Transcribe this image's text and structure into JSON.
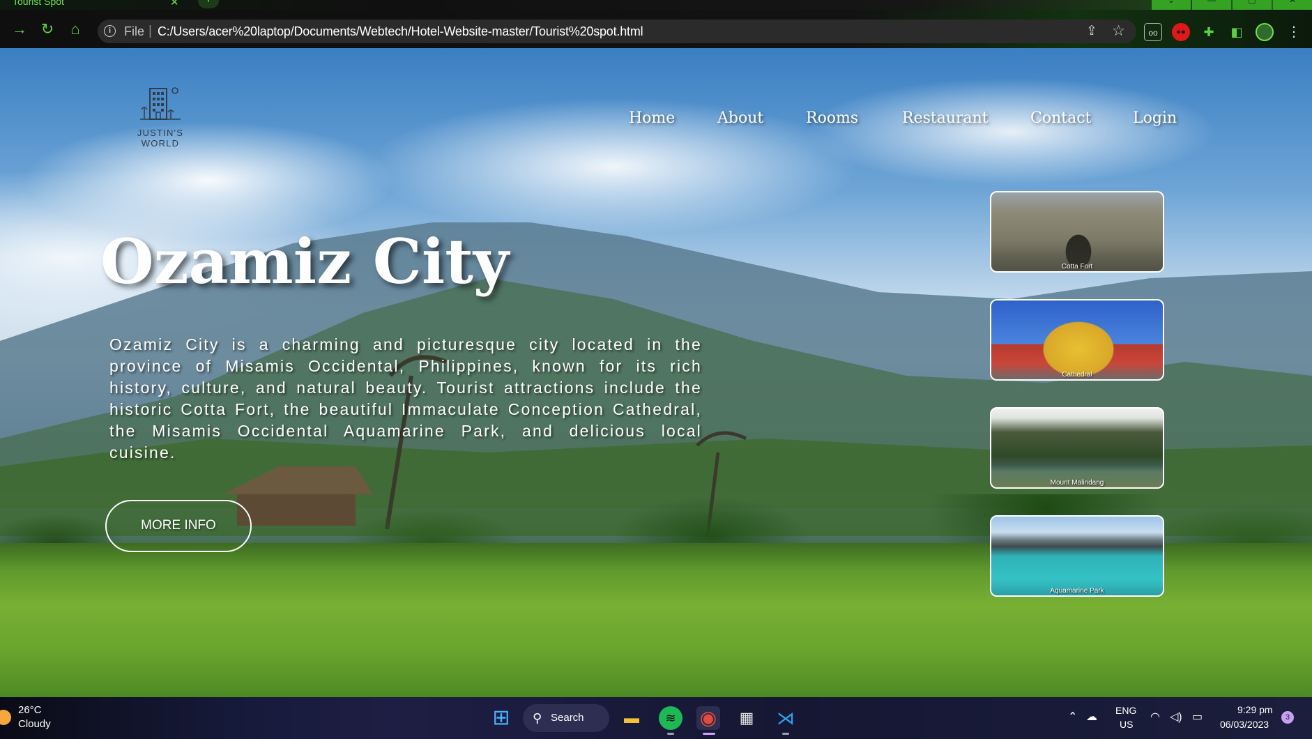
{
  "browser": {
    "tab_title": "Tourist Spot",
    "tab_close": "✕",
    "new_tab": "+",
    "omnibox_scheme": "File",
    "omnibox_url": "C:/Users/acer%20laptop/Documents/Webtech/Hotel-Website-master/Tourist%20spot.html"
  },
  "site": {
    "logo_text": "JUSTIN'S WORLD",
    "nav": [
      "Home",
      "About",
      "Rooms",
      "Restaurant",
      "Contact",
      "Login"
    ]
  },
  "hero": {
    "title": "Ozamiz City",
    "description": "Ozamiz City is a charming and picturesque city located in the province of Misamis Occidental, Philippines, known for its rich history, culture, and natural beauty. Tourist attractions include the historic Cotta Fort, the beautiful Immaculate Conception Cathedral, the Misamis Occidental Aquamarine Park, and delicious local cuisine.",
    "button": "MORE INFO"
  },
  "thumbnails": [
    {
      "label": "Cotta Fort"
    },
    {
      "label": "Cathedral"
    },
    {
      "label": "Mount Malindang"
    },
    {
      "label": "Aquamarine Park"
    }
  ],
  "taskbar": {
    "weather_temp": "26°C",
    "weather_desc": "Cloudy",
    "search_label": "Search",
    "lang_line1": "ENG",
    "lang_line2": "US",
    "time": "9:29 pm",
    "date": "06/03/2023",
    "notification_count": "3"
  },
  "colors": {
    "browser_accent": "#58d43c",
    "nav_text": "#ffffff",
    "taskbar_bg": "#161a3a"
  }
}
